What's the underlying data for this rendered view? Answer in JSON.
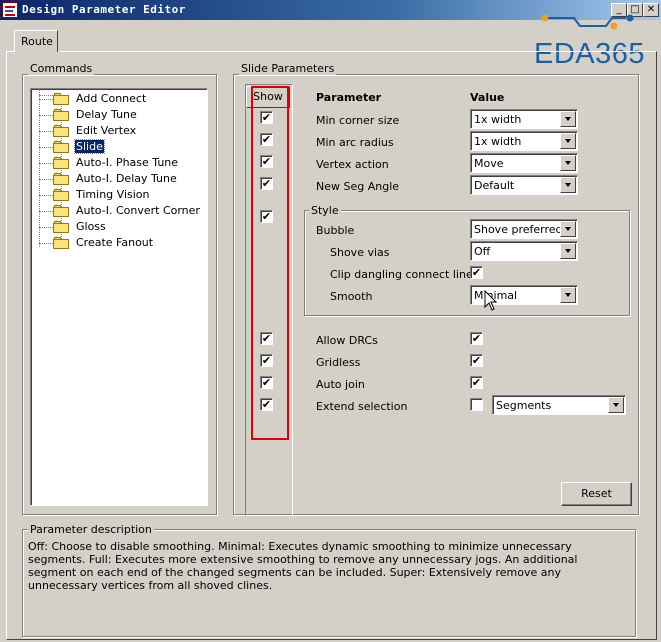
{
  "window": {
    "title": "Design Parameter Editor"
  },
  "tabs": [
    {
      "label": "Route"
    }
  ],
  "commands": {
    "label": "Commands",
    "items": [
      {
        "label": "Add Connect"
      },
      {
        "label": "Delay Tune"
      },
      {
        "label": "Edit Vertex"
      },
      {
        "label": "Slide",
        "selected": true
      },
      {
        "label": "Auto-I. Phase Tune"
      },
      {
        "label": "Auto-I. Delay Tune"
      },
      {
        "label": "Timing Vision"
      },
      {
        "label": "Auto-I. Convert Corner"
      },
      {
        "label": "Gloss"
      },
      {
        "label": "Create Fanout"
      }
    ]
  },
  "slide_params": {
    "label": "Slide Parameters",
    "show_header": "Show",
    "param_header": "Parameter",
    "value_header": "Value",
    "min_corner_size": {
      "label": "Min corner size",
      "value": "1x width"
    },
    "min_arc_radius": {
      "label": "Min arc radius",
      "value": "1x width"
    },
    "vertex_action": {
      "label": "Vertex action",
      "value": "Move"
    },
    "new_seg_angle": {
      "label": "New Seg Angle",
      "value": "Default"
    },
    "style": {
      "label": "Style",
      "bubble": {
        "label": "Bubble",
        "value": "Shove preferred"
      },
      "shove_vias": {
        "label": "Shove vias",
        "value": "Off"
      },
      "clip_dangling": {
        "label": "Clip dangling connect lines",
        "checked": true
      },
      "smooth": {
        "label": "Smooth",
        "value": "Minimal"
      }
    },
    "allow_drcs": {
      "label": "Allow DRCs",
      "checked": true
    },
    "gridless": {
      "label": "Gridless",
      "checked": true
    },
    "auto_join": {
      "label": "Auto join",
      "checked": true
    },
    "extend_selection": {
      "label": "Extend selection",
      "checked": false,
      "value": "Segments"
    },
    "reset_label": "Reset",
    "check_glyph": "✔"
  },
  "description": {
    "label": "Parameter description",
    "text": "Off: Choose to disable smoothing. Minimal: Executes dynamic smoothing to minimize unnecessary segments.  Full: Executes more extensive smoothing to remove any unnecessary jogs. An additional segment on each end of the changed segments can be included. Super: Extensively remove any unnecessary vertices from all shoved clines."
  },
  "watermark": {
    "text": "EDA365"
  },
  "colors": {
    "highlight": "#e00000",
    "selection": "#0a246a",
    "logo": "#1d5fa6"
  }
}
